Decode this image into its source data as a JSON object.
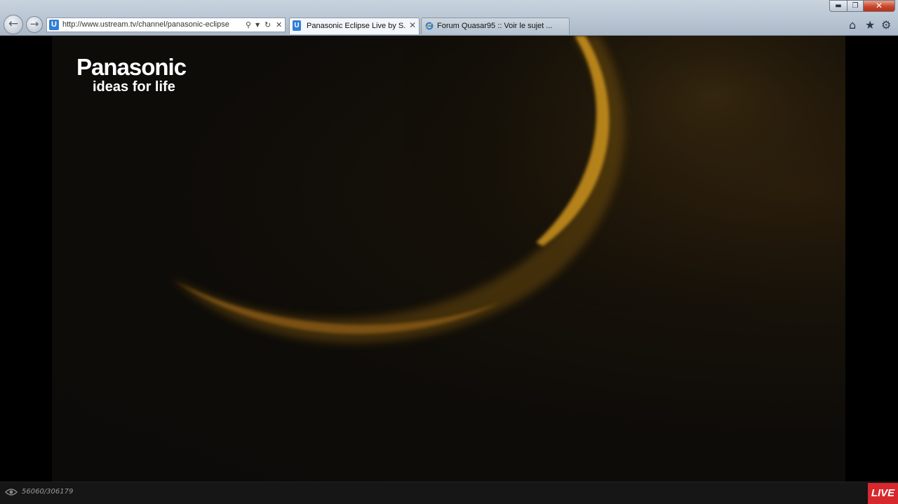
{
  "browser": {
    "url": "http://www.ustream.tv/channel/panasonic-eclipse",
    "favicon_letter": "U",
    "tabs": [
      {
        "title": "Panasonic Eclipse Live by S...",
        "active": true
      },
      {
        "title": "Forum Quasar95 :: Voir le sujet ...",
        "active": false
      }
    ],
    "icons": {
      "back": "back-arrow-icon",
      "forward": "forward-arrow-icon",
      "search": "search-icon",
      "refresh": "refresh-icon",
      "stop": "stop-icon",
      "home": "home-icon",
      "favorites": "star-icon",
      "tools": "gear-icon"
    },
    "window_buttons": {
      "minimize": "minimize-icon",
      "maximize": "maximize-icon",
      "close": "close-icon"
    }
  },
  "video": {
    "brand": "Panasonic",
    "tagline": "ideas for life"
  },
  "player_bar": {
    "viewer_count": "56060/306179",
    "live_label": "LIVE",
    "colors": {
      "live_bg": "#d7282d",
      "bar_bg": "#161616"
    }
  }
}
